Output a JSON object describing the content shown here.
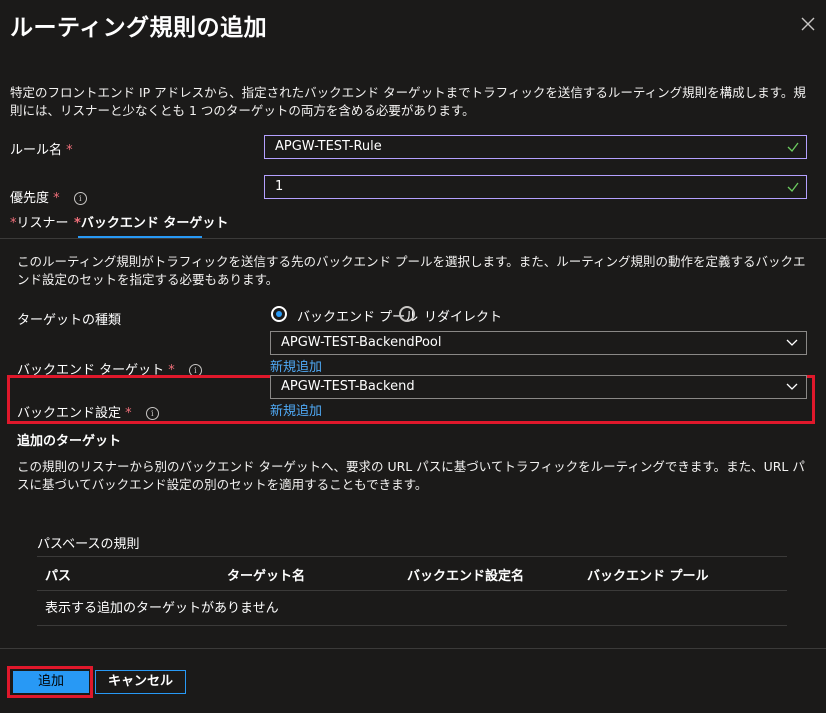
{
  "panel": {
    "title": "ルーティング規則の追加",
    "description": "特定のフロントエンド IP アドレスから、指定されたバックエンド ターゲットまでトラフィックを送信するルーティング規則を構成します。規則には、リスナーと少なくとも 1 つのターゲットの両方を含める必要があります。"
  },
  "form": {
    "rule_name": {
      "label": "ルール名",
      "required_mark": "*",
      "value": "APGW-TEST-Rule"
    },
    "priority": {
      "label": "優先度",
      "required_mark": "*",
      "value": "1"
    }
  },
  "tabs": [
    {
      "required_mark": "*",
      "label": "リスナー"
    },
    {
      "required_mark": "*",
      "label": "バックエンド ターゲット"
    }
  ],
  "backend_tab": {
    "description": "このルーティング規則がトラフィックを送信する先のバックエンド プールを選択します。また、ルーティング規則の動作を定義するバックエンド設定のセットを指定する必要もあります。",
    "target_type": {
      "label": "ターゲットの種類",
      "options": [
        "バックエンド プール",
        "リダイレクト"
      ],
      "selected": "バックエンド プール"
    },
    "backend_target": {
      "label": "バックエンド ターゲット",
      "required_mark": "*",
      "value": "APGW-TEST-BackendPool",
      "new_link": "新規追加"
    },
    "backend_settings": {
      "label": "バックエンド設定",
      "required_mark": "*",
      "value": "APGW-TEST-Backend",
      "new_link": "新規追加"
    },
    "additional_targets": {
      "heading": "追加のターゲット",
      "description": "この規則のリスナーから別のバックエンド ターゲットへ、要求の URL パスに基づいてトラフィックをルーティングできます。また、URL パスに基づいてバックエンド設定の別のセットを適用することもできます。"
    },
    "path_rules": {
      "heading": "パスベースの規則",
      "columns": [
        "パス",
        "ターゲット名",
        "バックエンド設定名",
        "バックエンド プール"
      ],
      "empty_message": "表示する追加のターゲットがありません"
    }
  },
  "footer": {
    "add_label": "追加",
    "cancel_label": "キャンセル"
  },
  "colors": {
    "accent": "#2899f5",
    "highlight": "#e0182b",
    "valid_border": "#b4a0ff",
    "valid_check": "#6ccb5f"
  }
}
